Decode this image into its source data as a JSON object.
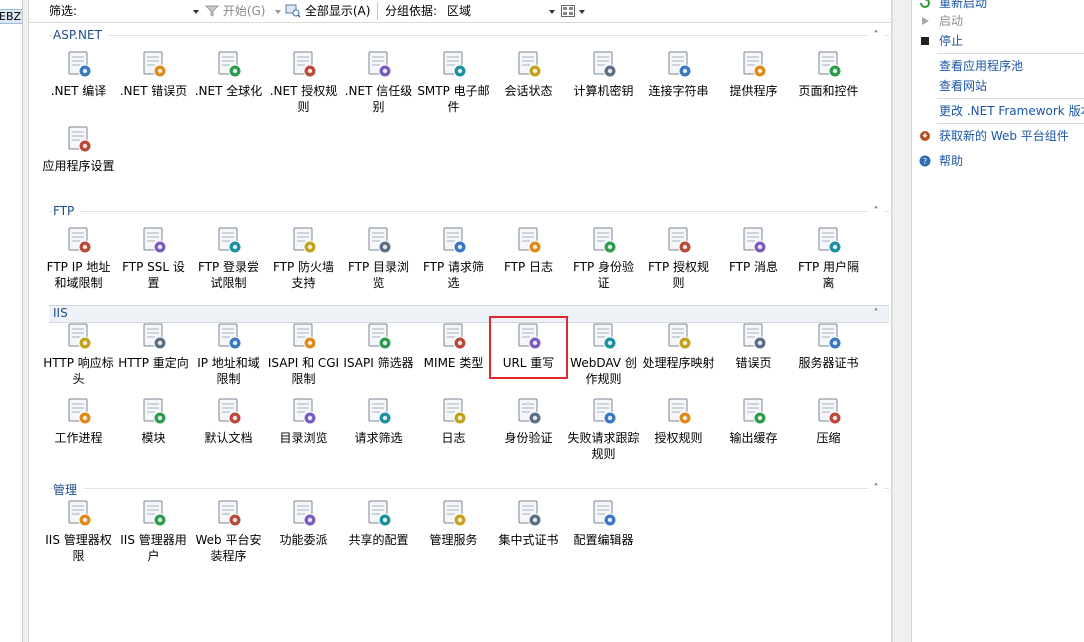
{
  "tree": {
    "node_label": "EBZ"
  },
  "toolbar": {
    "filter_label": "筛选:",
    "filter_value": "",
    "start_label": "开始(G)",
    "show_all_label": "全部显示(A)",
    "group_by_label": "分组依据:",
    "group_by_value": "区域"
  },
  "sections": [
    {
      "title": "ASP.NET",
      "items": [
        {
          "label": ".NET 编译",
          "icon": "dotnet-compile-icon"
        },
        {
          "label": ".NET 错误页",
          "icon": "dotnet-error-page-icon"
        },
        {
          "label": ".NET 全球化",
          "icon": "dotnet-globalization-icon"
        },
        {
          "label": ".NET 授权规则",
          "icon": "dotnet-authorization-icon"
        },
        {
          "label": ".NET 信任级别",
          "icon": "dotnet-trust-level-icon"
        },
        {
          "label": "SMTP 电子邮件",
          "icon": "smtp-email-icon"
        },
        {
          "label": "会话状态",
          "icon": "session-state-icon"
        },
        {
          "label": "计算机密钥",
          "icon": "machine-key-icon"
        },
        {
          "label": "连接字符串",
          "icon": "connection-string-icon"
        },
        {
          "label": "提供程序",
          "icon": "providers-icon"
        },
        {
          "label": "页面和控件",
          "icon": "pages-controls-icon"
        },
        {
          "label": "应用程序设置",
          "icon": "app-settings-icon"
        }
      ]
    },
    {
      "title": "FTP",
      "items": [
        {
          "label": "FTP IP 地址和域限制",
          "icon": "ftp-ip-restrict-icon"
        },
        {
          "label": "FTP SSL 设置",
          "icon": "ftp-ssl-icon"
        },
        {
          "label": "FTP 登录尝试限制",
          "icon": "ftp-logon-attempt-icon"
        },
        {
          "label": "FTP 防火墙支持",
          "icon": "ftp-firewall-icon"
        },
        {
          "label": "FTP 目录浏览",
          "icon": "ftp-dir-browse-icon"
        },
        {
          "label": "FTP 请求筛选",
          "icon": "ftp-request-filter-icon"
        },
        {
          "label": "FTP 日志",
          "icon": "ftp-logging-icon"
        },
        {
          "label": "FTP 身份验证",
          "icon": "ftp-authentication-icon"
        },
        {
          "label": "FTP 授权规则",
          "icon": "ftp-authorization-icon"
        },
        {
          "label": "FTP 消息",
          "icon": "ftp-messages-icon"
        },
        {
          "label": "FTP 用户隔离",
          "icon": "ftp-user-isolation-icon"
        }
      ]
    },
    {
      "title": "IIS",
      "items": [
        {
          "label": "HTTP 响应标头",
          "icon": "http-response-headers-icon"
        },
        {
          "label": "HTTP 重定向",
          "icon": "http-redirect-icon"
        },
        {
          "label": "IP 地址和域限制",
          "icon": "ip-domain-restrict-icon"
        },
        {
          "label": "ISAPI 和 CGI 限制",
          "icon": "isapi-cgi-icon"
        },
        {
          "label": "ISAPI 筛选器",
          "icon": "isapi-filters-icon"
        },
        {
          "label": "MIME 类型",
          "icon": "mime-types-icon"
        },
        {
          "label": "URL 重写",
          "icon": "url-rewrite-icon",
          "selected": true
        },
        {
          "label": "WebDAV 创作规则",
          "icon": "webdav-icon"
        },
        {
          "label": "处理程序映射",
          "icon": "handler-mappings-icon"
        },
        {
          "label": "错误页",
          "icon": "error-pages-icon"
        },
        {
          "label": "服务器证书",
          "icon": "server-certificates-icon"
        },
        {
          "label": "工作进程",
          "icon": "worker-processes-icon"
        },
        {
          "label": "模块",
          "icon": "modules-icon"
        },
        {
          "label": "默认文档",
          "icon": "default-document-icon"
        },
        {
          "label": "目录浏览",
          "icon": "directory-browsing-icon"
        },
        {
          "label": "请求筛选",
          "icon": "request-filtering-icon"
        },
        {
          "label": "日志",
          "icon": "logging-icon"
        },
        {
          "label": "身份验证",
          "icon": "authentication-icon"
        },
        {
          "label": "失败请求跟踪规则",
          "icon": "failed-request-tracing-icon"
        },
        {
          "label": "授权规则",
          "icon": "authorization-rules-icon"
        },
        {
          "label": "输出缓存",
          "icon": "output-caching-icon"
        },
        {
          "label": "压缩",
          "icon": "compression-icon"
        }
      ]
    },
    {
      "title": "管理",
      "items": [
        {
          "label": "IIS 管理器权限",
          "icon": "iis-manager-permissions-icon"
        },
        {
          "label": "IIS 管理器用户",
          "icon": "iis-manager-users-icon"
        },
        {
          "label": "Web 平台安装程序",
          "icon": "web-platform-installer-icon"
        },
        {
          "label": "功能委派",
          "icon": "feature-delegation-icon"
        },
        {
          "label": "共享的配置",
          "icon": "shared-configuration-icon"
        },
        {
          "label": "管理服务",
          "icon": "management-service-icon"
        },
        {
          "label": "集中式证书",
          "icon": "centralized-certificates-icon"
        },
        {
          "label": "配置编辑器",
          "icon": "configuration-editor-icon"
        }
      ]
    }
  ],
  "actions": {
    "restart": "重新启动",
    "start": "启动",
    "stop": "停止",
    "view_app_pools": "查看应用程序池",
    "view_sites": "查看网站",
    "change_framework": "更改 .NET Framework 版本",
    "get_web_platform": "获取新的 Web 平台组件",
    "help": "帮助"
  },
  "colors": {
    "accent": "#1a56a6",
    "selection": "#e0292c",
    "section_title": "#1e4e8c"
  }
}
